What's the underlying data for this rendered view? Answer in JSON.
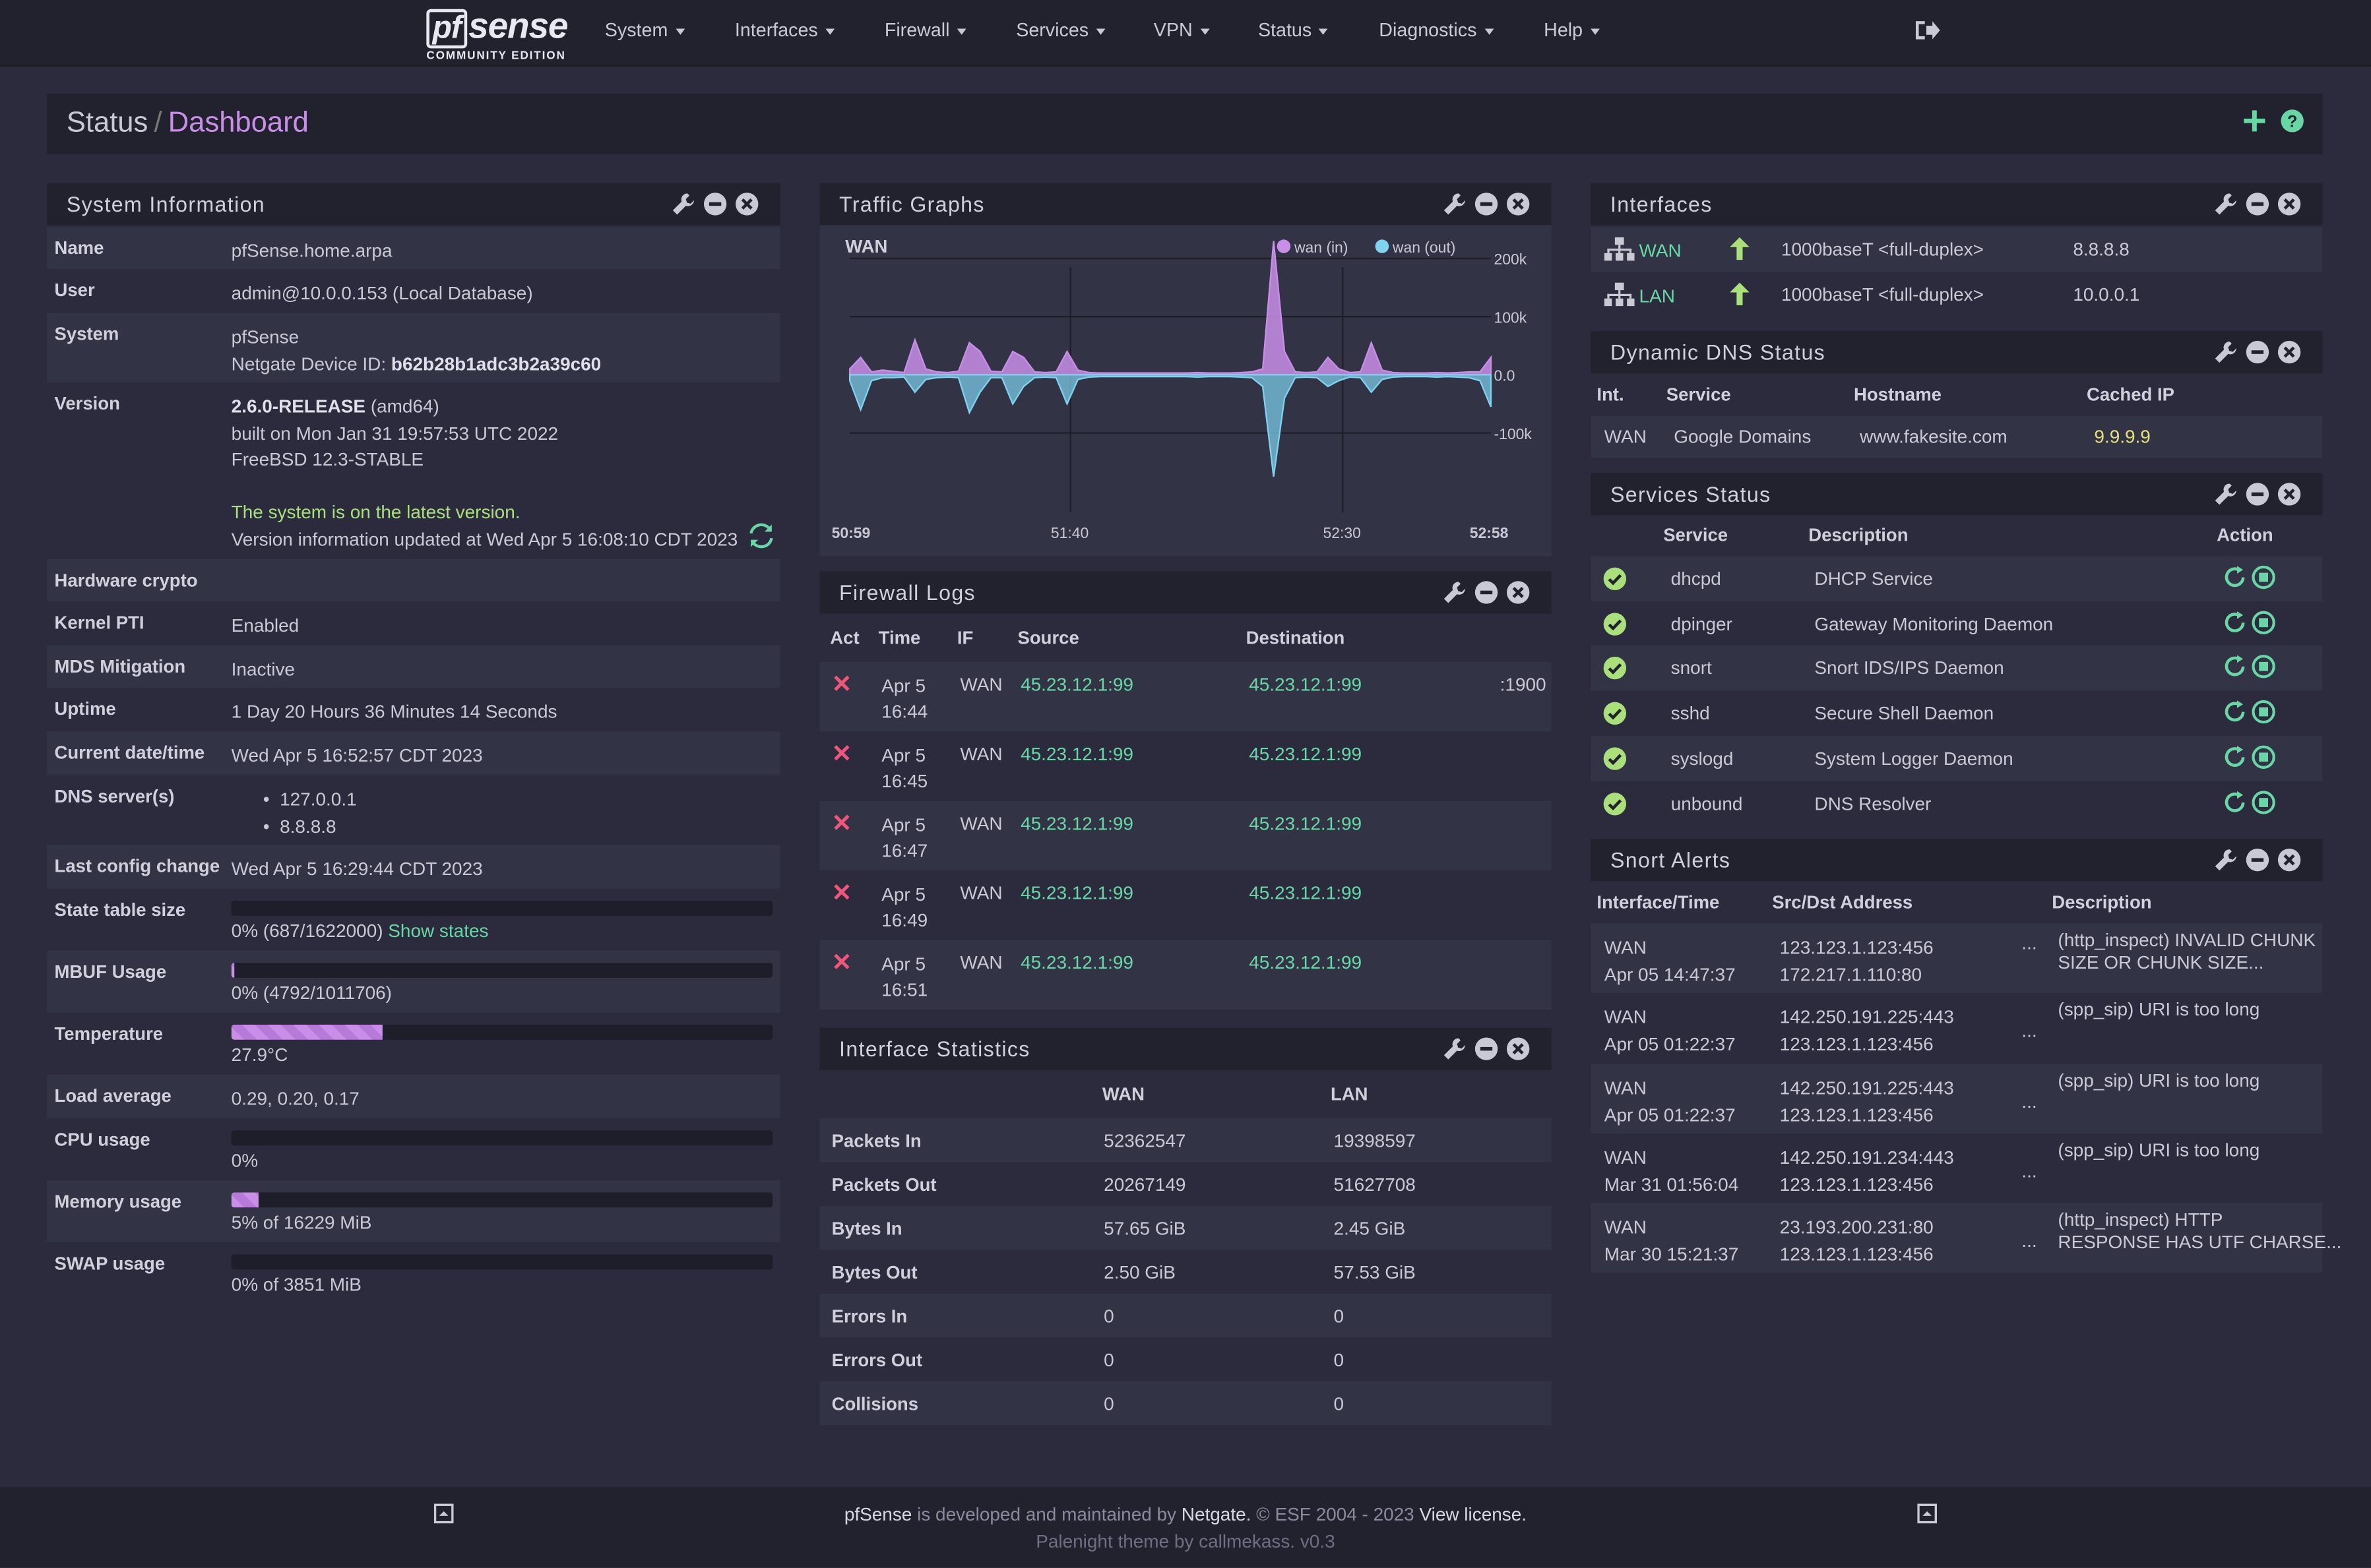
{
  "nav": {
    "brand_pf": "pf",
    "brand_sense": "sense",
    "brand_sub": "COMMUNITY EDITION",
    "menus": [
      "System",
      "Interfaces",
      "Firewall",
      "Services",
      "VPN",
      "Status",
      "Diagnostics",
      "Help"
    ]
  },
  "breadcrumb": {
    "parent": "Status",
    "separator": "/",
    "current": "Dashboard"
  },
  "system_info": {
    "title": "System Information",
    "rows": {
      "name_k": "Name",
      "name_v": "pfSense.home.arpa",
      "user_k": "User",
      "user_v": "admin@10.0.0.153 (Local Database)",
      "system_k": "System",
      "system_v1": "pfSense",
      "system_v2": "Netgate Device ID: ",
      "system_id": "b62b28b1adc3b2a39c60",
      "version_k": "Version",
      "version_rel": "2.6.0-RELEASE",
      "version_arch": " (amd64)",
      "version_built": "built on Mon Jan 31 19:57:53 UTC 2022",
      "version_os": "FreeBSD 12.3-STABLE",
      "version_latest": "The system is on the latest version.",
      "version_updated": "Version information updated at Wed Apr 5 16:08:10 CDT 2023",
      "hwcrypto_k": "Hardware crypto",
      "kpti_k": "Kernel PTI",
      "kpti_v": "Enabled",
      "mds_k": "MDS Mitigation",
      "mds_v": "Inactive",
      "uptime_k": "Uptime",
      "uptime_v": "1 Day 20 Hours 36 Minutes 14 Seconds",
      "date_k": "Current date/time",
      "date_v": "Wed Apr 5 16:52:57 CDT 2023",
      "dns_k": "DNS server(s)",
      "dns_1": "127.0.0.1",
      "dns_2": "8.8.8.8",
      "lastcfg_k": "Last config change",
      "lastcfg_v": "Wed Apr 5 16:29:44 CDT 2023",
      "state_k": "State table size",
      "state_v": "0% (687/1622000) ",
      "state_link": "Show states",
      "mbuf_k": "MBUF Usage",
      "mbuf_v": "0% (4792/1011706)",
      "temp_k": "Temperature",
      "temp_v": "27.9°C",
      "load_k": "Load average",
      "load_v": "0.29, 0.20, 0.17",
      "cpu_k": "CPU usage",
      "cpu_v": "0%",
      "mem_k": "Memory usage",
      "mem_v": "5% of 16229 MiB",
      "swap_k": "SWAP usage",
      "swap_v": "0% of 3851 MiB"
    },
    "bars": {
      "state": 0.0,
      "mbuf": 0.005,
      "temp": 0.279,
      "cpu": 0.0,
      "mem": 0.05,
      "swap": 0.0
    }
  },
  "traffic": {
    "title": "Traffic Graphs",
    "graph_label": "WAN",
    "legend_in": "wan (in)",
    "legend_out": "wan (out)",
    "y_ticks": [
      "200k",
      "100k",
      "0.0",
      "-100k"
    ],
    "x_ticks": [
      "50:59",
      "51:40",
      "52:30",
      "52:58"
    ],
    "colors": {
      "in": "#c88ee8",
      "out": "#7fd3f0"
    },
    "chart_data": {
      "type": "area",
      "ylim": [
        -200000,
        200000
      ],
      "series": [
        {
          "name": "wan (in)",
          "values": [
            10000,
            30000,
            5000,
            8000,
            6000,
            4000,
            60000,
            10000,
            5000,
            4000,
            6000,
            55000,
            40000,
            6000,
            5000,
            40000,
            30000,
            5000,
            4000,
            5000,
            40000,
            8000,
            4000,
            3000,
            3000,
            3000,
            3000,
            3000,
            3000,
            3000,
            3000,
            3000,
            4000,
            3000,
            3000,
            3000,
            4000,
            5000,
            10000,
            230000,
            40000,
            5000,
            4000,
            5000,
            30000,
            10000,
            4000,
            5000,
            55000,
            8000,
            4000,
            3000,
            3000,
            3000,
            4000,
            3000,
            4000,
            5000,
            5000,
            30000
          ]
        },
        {
          "name": "wan (out)",
          "values": [
            -10000,
            -60000,
            -10000,
            -5000,
            -5000,
            -4000,
            -30000,
            -8000,
            -5000,
            -4000,
            -5000,
            -65000,
            -30000,
            -5000,
            -5000,
            -50000,
            -20000,
            -5000,
            -4000,
            -5000,
            -50000,
            -8000,
            -4000,
            -3000,
            -3000,
            -3000,
            -3000,
            -3000,
            -3000,
            -3000,
            -3000,
            -3000,
            -4000,
            -3000,
            -3000,
            -3000,
            -4000,
            -5000,
            -20000,
            -175000,
            -40000,
            -5000,
            -4000,
            -5000,
            -20000,
            -10000,
            -4000,
            -5000,
            -30000,
            -8000,
            -4000,
            -3000,
            -3000,
            -3000,
            -4000,
            -3000,
            -4000,
            -5000,
            -10000,
            -55000
          ]
        }
      ]
    }
  },
  "fwlogs": {
    "title": "Firewall Logs",
    "headers": [
      "Act",
      "Time",
      "IF",
      "Source",
      "Destination"
    ],
    "rows": [
      {
        "date": "Apr 5",
        "time": "16:44",
        "if": "WAN",
        "src": "45.23.12.1:99",
        "dst": "45.23.12.1:99",
        "extra": ":1900"
      },
      {
        "date": "Apr 5",
        "time": "16:45",
        "if": "WAN",
        "src": "45.23.12.1:99",
        "dst": "45.23.12.1:99",
        "extra": ""
      },
      {
        "date": "Apr 5",
        "time": "16:47",
        "if": "WAN",
        "src": "45.23.12.1:99",
        "dst": "45.23.12.1:99",
        "extra": ""
      },
      {
        "date": "Apr 5",
        "time": "16:49",
        "if": "WAN",
        "src": "45.23.12.1:99",
        "dst": "45.23.12.1:99",
        "extra": ""
      },
      {
        "date": "Apr 5",
        "time": "16:51",
        "if": "WAN",
        "src": "45.23.12.1:99",
        "dst": "45.23.12.1:99",
        "extra": ""
      }
    ]
  },
  "ifstats": {
    "title": "Interface Statistics",
    "headers": [
      "WAN",
      "LAN"
    ],
    "rows": [
      {
        "label": "Packets In",
        "wan": "52362547",
        "lan": "19398597"
      },
      {
        "label": "Packets Out",
        "wan": "20267149",
        "lan": "51627708"
      },
      {
        "label": "Bytes In",
        "wan": "57.65 GiB",
        "lan": "2.45 GiB"
      },
      {
        "label": "Bytes Out",
        "wan": "2.50 GiB",
        "lan": "57.53 GiB"
      },
      {
        "label": "Errors In",
        "wan": "0",
        "lan": "0"
      },
      {
        "label": "Errors Out",
        "wan": "0",
        "lan": "0"
      },
      {
        "label": "Collisions",
        "wan": "0",
        "lan": "0"
      }
    ]
  },
  "interfaces": {
    "title": "Interfaces",
    "rows": [
      {
        "name": "WAN",
        "media": "1000baseT <full-duplex>",
        "ip": "8.8.8.8"
      },
      {
        "name": "LAN",
        "media": "1000baseT <full-duplex>",
        "ip": "10.0.0.1"
      }
    ]
  },
  "ddns": {
    "title": "Dynamic DNS Status",
    "headers": [
      "Int.",
      "Service",
      "Hostname",
      "Cached IP"
    ],
    "row": {
      "int": "WAN",
      "service": "Google Domains",
      "host": "www.fakesite.com",
      "ip": "9.9.9.9"
    }
  },
  "services": {
    "title": "Services Status",
    "headers": [
      "Service",
      "Description",
      "Action"
    ],
    "rows": [
      {
        "name": "dhcpd",
        "desc": "DHCP Service"
      },
      {
        "name": "dpinger",
        "desc": "Gateway Monitoring Daemon"
      },
      {
        "name": "snort",
        "desc": "Snort IDS/IPS Daemon"
      },
      {
        "name": "sshd",
        "desc": "Secure Shell Daemon"
      },
      {
        "name": "syslogd",
        "desc": "System Logger Daemon"
      },
      {
        "name": "unbound",
        "desc": "DNS Resolver"
      }
    ]
  },
  "snort": {
    "title": "Snort Alerts",
    "headers": [
      "Interface/Time",
      "Src/Dst Address",
      "Description"
    ],
    "rows": [
      {
        "if": "WAN",
        "time": "Apr 05 14:47:37",
        "src": "123.123.1.123:456",
        "dst": "172.217.1.110:80",
        "d1": "(http_inspect) INVALID CHUNK",
        "d2": "SIZE OR CHUNK SIZE..."
      },
      {
        "if": "WAN",
        "time": "Apr 05 01:22:37",
        "src": "142.250.191.225:443",
        "dst": "123.123.1.123:456",
        "d1": "(spp_sip) URI is too long",
        "d2": ""
      },
      {
        "if": "WAN",
        "time": "Apr 05 01:22:37",
        "src": "142.250.191.225:443",
        "dst": "123.123.1.123:456",
        "d1": "(spp_sip) URI is too long",
        "d2": ""
      },
      {
        "if": "WAN",
        "time": "Mar 31 01:56:04",
        "src": "142.250.191.234:443",
        "dst": "123.123.1.123:456",
        "d1": "(spp_sip) URI is too long",
        "d2": ""
      },
      {
        "if": "WAN",
        "time": "Mar 30 15:21:37",
        "src": "23.193.200.231:80",
        "dst": "123.123.1.123:456",
        "d1": "(http_inspect) HTTP",
        "d2": "RESPONSE HAS UTF CHARSE..."
      }
    ]
  },
  "footer": {
    "p1": "pfSense",
    "p2": " is developed and maintained by ",
    "p3": "Netgate.",
    "p4": " © ESF 2004 - 2023 ",
    "p5": "View license.",
    "line2": "Palenight theme by callmekass. v0.3"
  }
}
